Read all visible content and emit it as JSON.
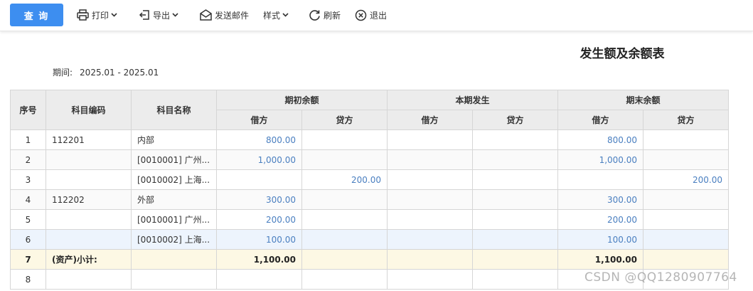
{
  "toolbar": {
    "query_label": "查 询",
    "print_label": "打印",
    "export_label": "导出",
    "email_label": "发送邮件",
    "style_label": "样式",
    "refresh_label": "刷新",
    "exit_label": "退出"
  },
  "report": {
    "title": "发生额及余额表",
    "period_label": "期间:",
    "period_value": "2025.01 - 2025.01"
  },
  "table": {
    "headers": {
      "index": "序号",
      "code": "科目编码",
      "name": "科目名称",
      "opening": "期初余额",
      "current": "本期发生",
      "closing": "期末余额",
      "debit": "借方",
      "credit": "贷方"
    },
    "rows": [
      {
        "idx": "1",
        "code": "112201",
        "name": "内部",
        "od": "800.00",
        "oc": "",
        "cd": "",
        "cc": "",
        "ed": "800.00",
        "ec": "",
        "style": ""
      },
      {
        "idx": "2",
        "code": "",
        "name": "[0010001] 广州...",
        "od": "1,000.00",
        "oc": "",
        "cd": "",
        "cc": "",
        "ed": "1,000.00",
        "ec": "",
        "style": "alt"
      },
      {
        "idx": "3",
        "code": "",
        "name": "[0010002] 上海...",
        "od": "",
        "oc": "200.00",
        "cd": "",
        "cc": "",
        "ed": "",
        "ec": "200.00",
        "style": ""
      },
      {
        "idx": "4",
        "code": "112202",
        "name": "外部",
        "od": "300.00",
        "oc": "",
        "cd": "",
        "cc": "",
        "ed": "300.00",
        "ec": "",
        "style": "alt"
      },
      {
        "idx": "5",
        "code": "",
        "name": "[0010001] 广州...",
        "od": "200.00",
        "oc": "",
        "cd": "",
        "cc": "",
        "ed": "200.00",
        "ec": "",
        "style": ""
      },
      {
        "idx": "6",
        "code": "",
        "name": "[0010002] 上海...",
        "od": "100.00",
        "oc": "",
        "cd": "",
        "cc": "",
        "ed": "100.00",
        "ec": "",
        "style": "hl"
      },
      {
        "idx": "7",
        "code": "(资产)小计:",
        "name": "",
        "od": "1,100.00",
        "oc": "",
        "cd": "",
        "cc": "",
        "ed": "1,100.00",
        "ec": "",
        "style": "sub"
      },
      {
        "idx": "8",
        "code": "",
        "name": "",
        "od": "",
        "oc": "",
        "cd": "",
        "cc": "",
        "ed": "",
        "ec": "",
        "style": ""
      }
    ]
  },
  "watermark": "CSDN @QQ1280907764",
  "colors": {
    "accent": "#3d8ef0",
    "amount_text": "#4a7fc0",
    "header_bg": "#ececec",
    "subtotal_bg": "#fdf8e4",
    "selected_row_bg": "#edf4fd"
  }
}
